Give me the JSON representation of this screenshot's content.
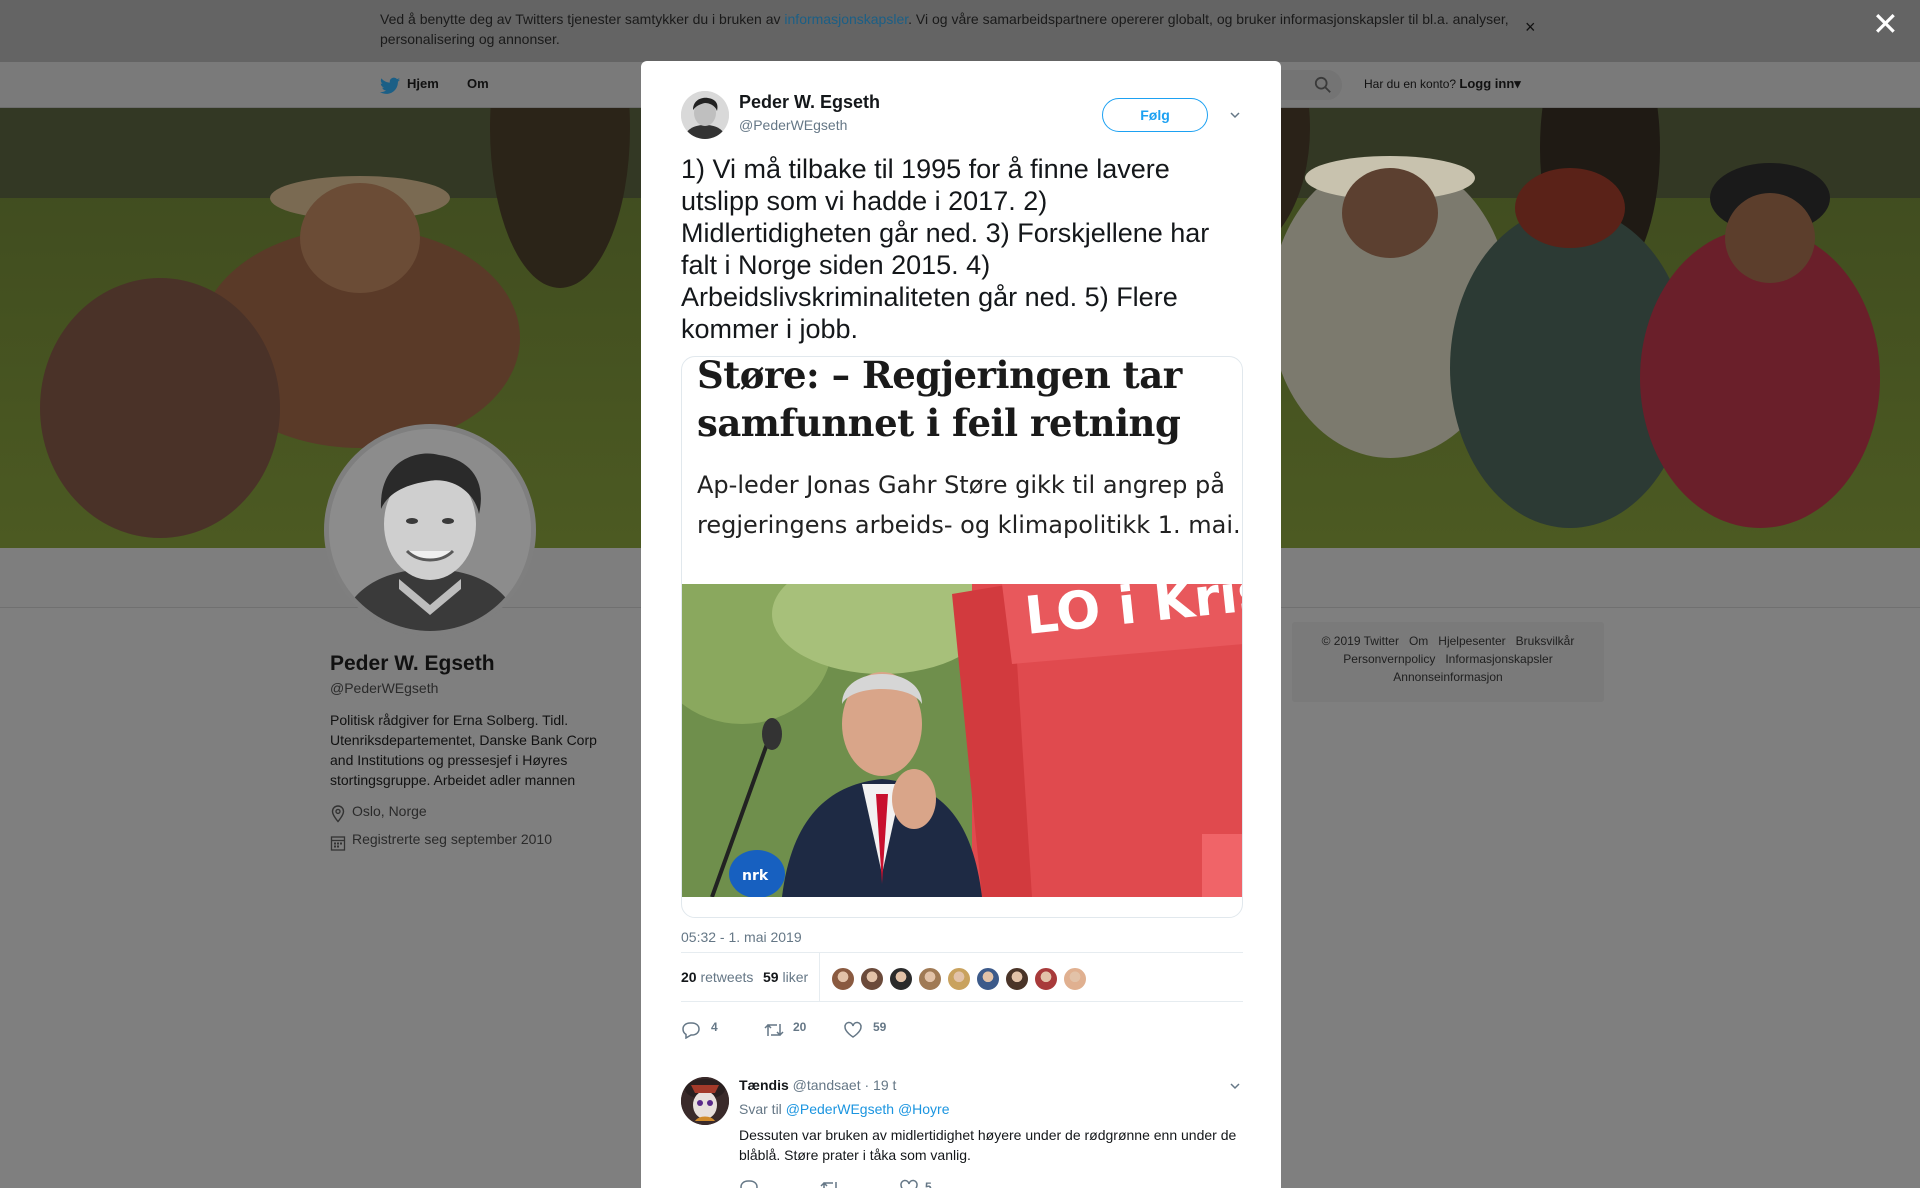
{
  "cookie_banner": {
    "text_before": "Ved å benytte deg av Twitters tjenester samtykker du i bruken av ",
    "link": "informasjonskapsler",
    "text_after": ". Vi og våre samarbeidspartnere opererer globalt, og bruker informasjonskapsler til bl.a. analyser, personalisering og annonser.",
    "close_glyph": "×"
  },
  "overlay_close_glyph": "✕",
  "nav": {
    "home": "Hjem",
    "about": "Om",
    "login_hint": "Har du en konto?",
    "login": "Logg inn",
    "login_caret": "▾"
  },
  "profile": {
    "name": "Peder W. Egseth",
    "handle": "@PederWEgseth",
    "bio": "Politisk rådgiver for Erna Solberg. Tidl. Utenriksdepartementet, Danske Bank Corp and Institutions og pressesjef i Høyres stortingsgruppe. Arbeidet adler mannen",
    "location": "Oslo, Norge",
    "joined": "Registrerte seg september 2010"
  },
  "footer": {
    "line1": [
      "© 2019 Twitter",
      "Om",
      "Hjelpesenter",
      "Bruksvilkår"
    ],
    "line2": [
      "Personvernpolicy",
      "Informasjonskapsler"
    ],
    "line3": [
      "Annonseinformasjon"
    ]
  },
  "tweet": {
    "author_name": "Peder W. Egseth",
    "author_handle": "@PederWEgseth",
    "follow_label": "Følg",
    "text": "1) Vi må tilbake til 1995 for å finne lavere utslipp som vi hadde i 2017. 2) Midlertidigheten går ned. 3) Forskjellene har falt i Norge siden 2015. 4) Arbeidslivskriminaliteten går ned. 5) Flere kommer i jobb.",
    "media": {
      "headline": "Støre: – Regjeringen tar samfunnet i feil retning",
      "lede": "Ap-leder Jonas Gahr Støre gikk til angrep på regjeringens arbeids- og klimapolitikk 1. mai.",
      "banner_text": "LO i Krist",
      "mic_logo": "nrk"
    },
    "timestamp": "05:32 - 1. mai 2019",
    "retweets_count": "20",
    "retweets_label": "retweets",
    "likes_count": "59",
    "likes_label": "liker",
    "actions": {
      "replies": "4",
      "retweets": "20",
      "likes": "59"
    },
    "liker_colors": [
      "#8a5a40",
      "#6b4a3a",
      "#2b2b2b",
      "#a07a55",
      "#c9a25e",
      "#3c5a8a",
      "#4a3428",
      "#a83a3a",
      "#e0b090"
    ]
  },
  "reply": {
    "name": "Tændis",
    "handle": "@tandsaet",
    "sep": "·",
    "time": "19 t",
    "reply_to_label": "Svar til",
    "reply_to_1": "@PederWEgseth",
    "reply_to_2": "@Hoyre",
    "text": "Dessuten var bruken av midlertidighet høyere under de rødgrønne enn under de blåblå. Støre prater i tåka som vanlig.",
    "likes": "5"
  }
}
